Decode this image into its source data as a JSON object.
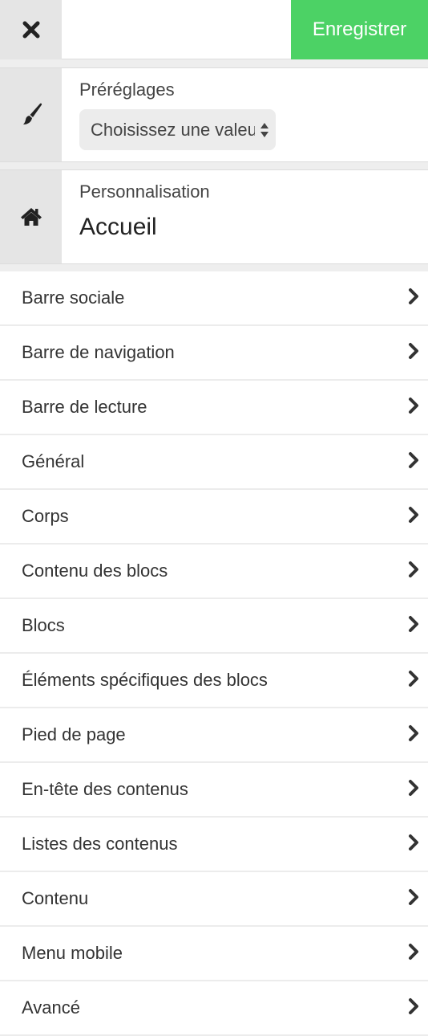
{
  "topbar": {
    "close_icon": "close-icon",
    "save_label": "Enregistrer",
    "accent_color": "#4cd265"
  },
  "presets": {
    "icon": "paintbrush-icon",
    "label": "Préréglages",
    "select_value": "Choisissez une valeur"
  },
  "customization": {
    "icon": "home-icon",
    "label": "Personnalisation",
    "title": "Accueil"
  },
  "menu": {
    "items": [
      {
        "label": "Barre sociale"
      },
      {
        "label": "Barre de navigation"
      },
      {
        "label": "Barre de lecture"
      },
      {
        "label": "Général"
      },
      {
        "label": "Corps"
      },
      {
        "label": "Contenu des blocs"
      },
      {
        "label": "Blocs"
      },
      {
        "label": "Éléments spécifiques des blocs"
      },
      {
        "label": "Pied de page"
      },
      {
        "label": "En-tête des contenus"
      },
      {
        "label": "Listes des contenus"
      },
      {
        "label": "Contenu"
      },
      {
        "label": "Menu mobile"
      },
      {
        "label": "Avancé"
      }
    ]
  }
}
